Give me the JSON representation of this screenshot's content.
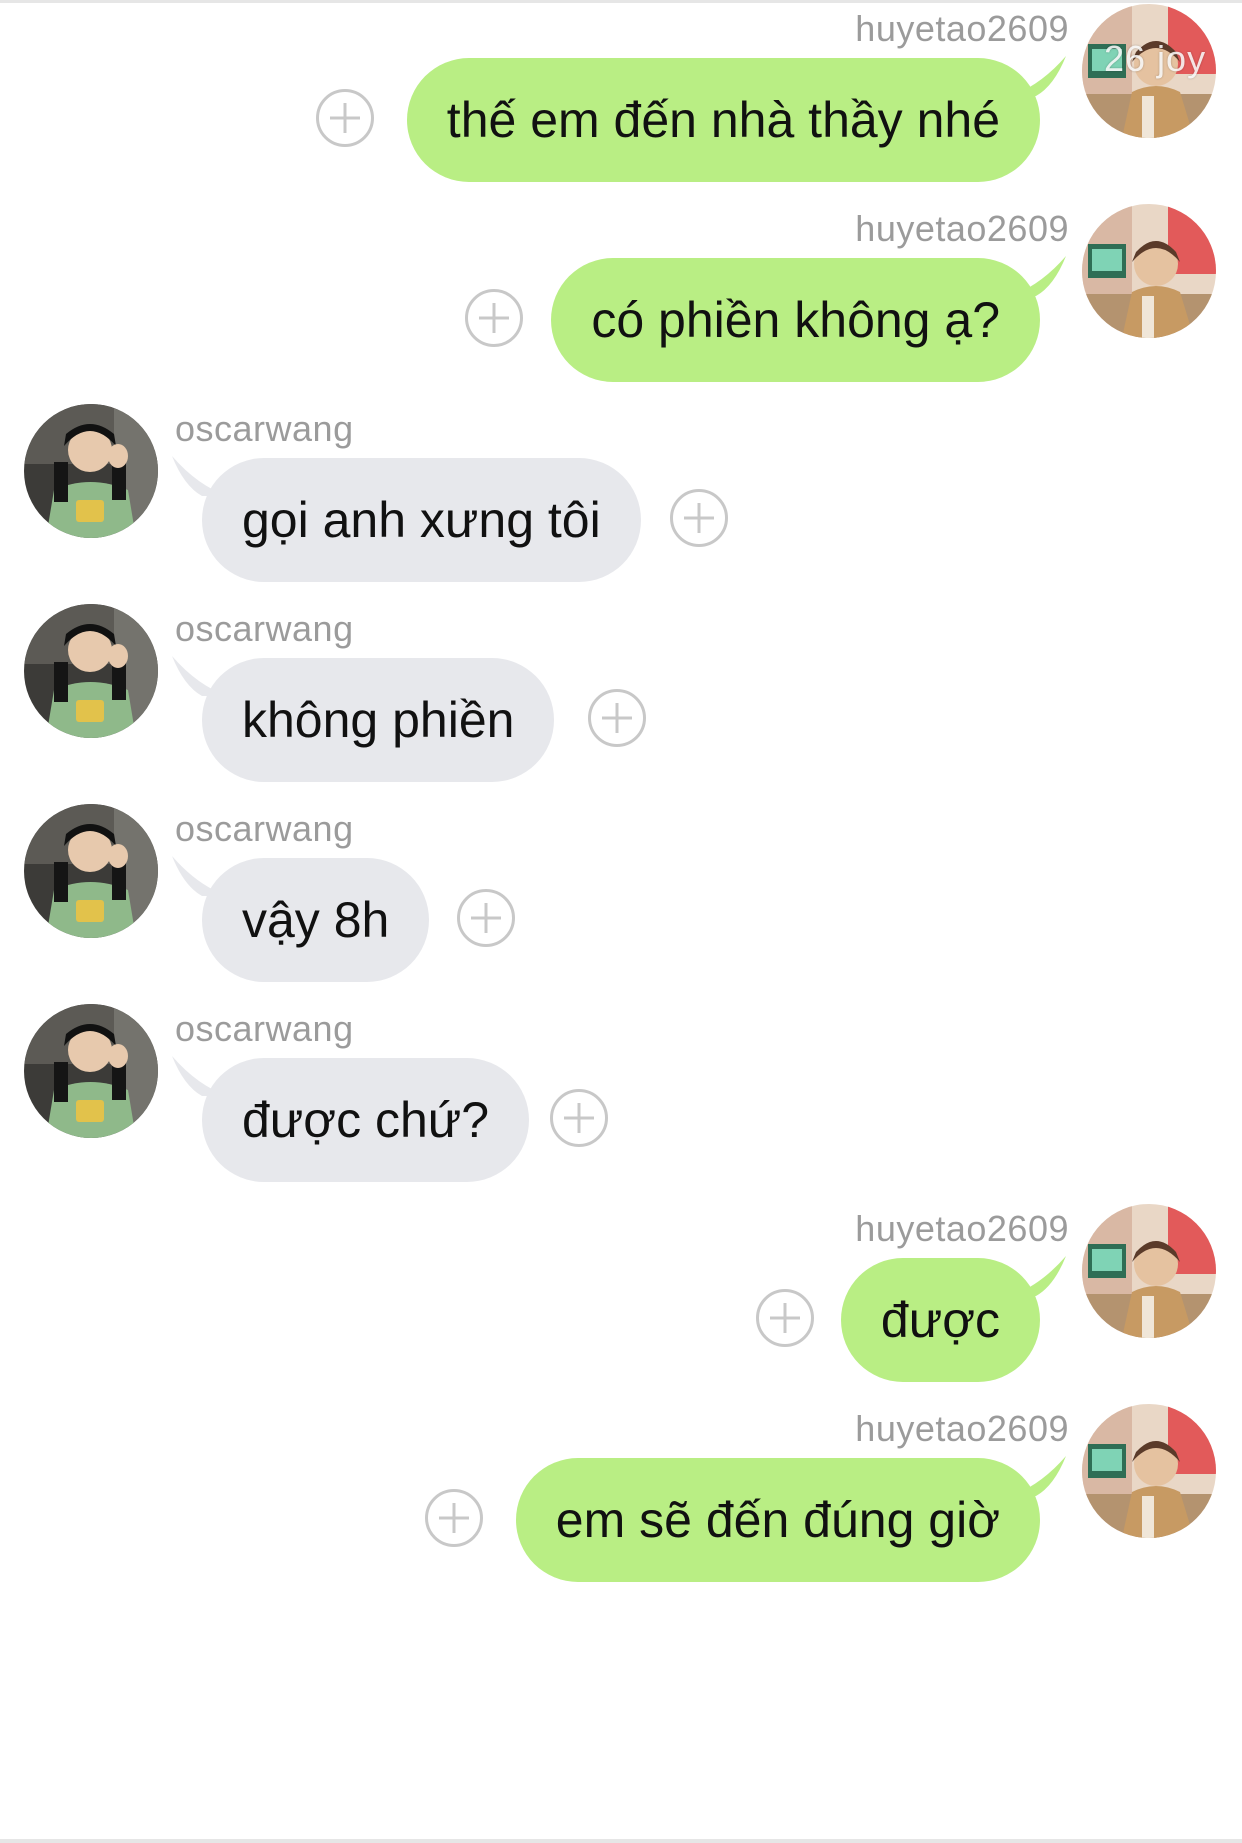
{
  "colors": {
    "outgoing_bubble": "#b9ee84",
    "incoming_bubble": "#e7e8ec",
    "username": "#9b9b9b",
    "plus_icon": "#c8c8c8"
  },
  "top_badge": "26 joy",
  "messages": [
    {
      "direction": "outgoing",
      "user": "huyetao2609",
      "text": "thế em đến nhà thầy nhé"
    },
    {
      "direction": "outgoing",
      "user": "huyetao2609",
      "text": "có phiền không ạ?"
    },
    {
      "direction": "incoming",
      "user": "oscarwang",
      "text": "gọi anh xưng tôi"
    },
    {
      "direction": "incoming",
      "user": "oscarwang",
      "text": "không phiền"
    },
    {
      "direction": "incoming",
      "user": "oscarwang",
      "text": "vậy 8h"
    },
    {
      "direction": "incoming",
      "user": "oscarwang",
      "text": "được chứ?"
    },
    {
      "direction": "outgoing",
      "user": "huyetao2609",
      "text": "được"
    },
    {
      "direction": "outgoing",
      "user": "huyetao2609",
      "text": "em sẽ đến đúng giờ"
    }
  ]
}
